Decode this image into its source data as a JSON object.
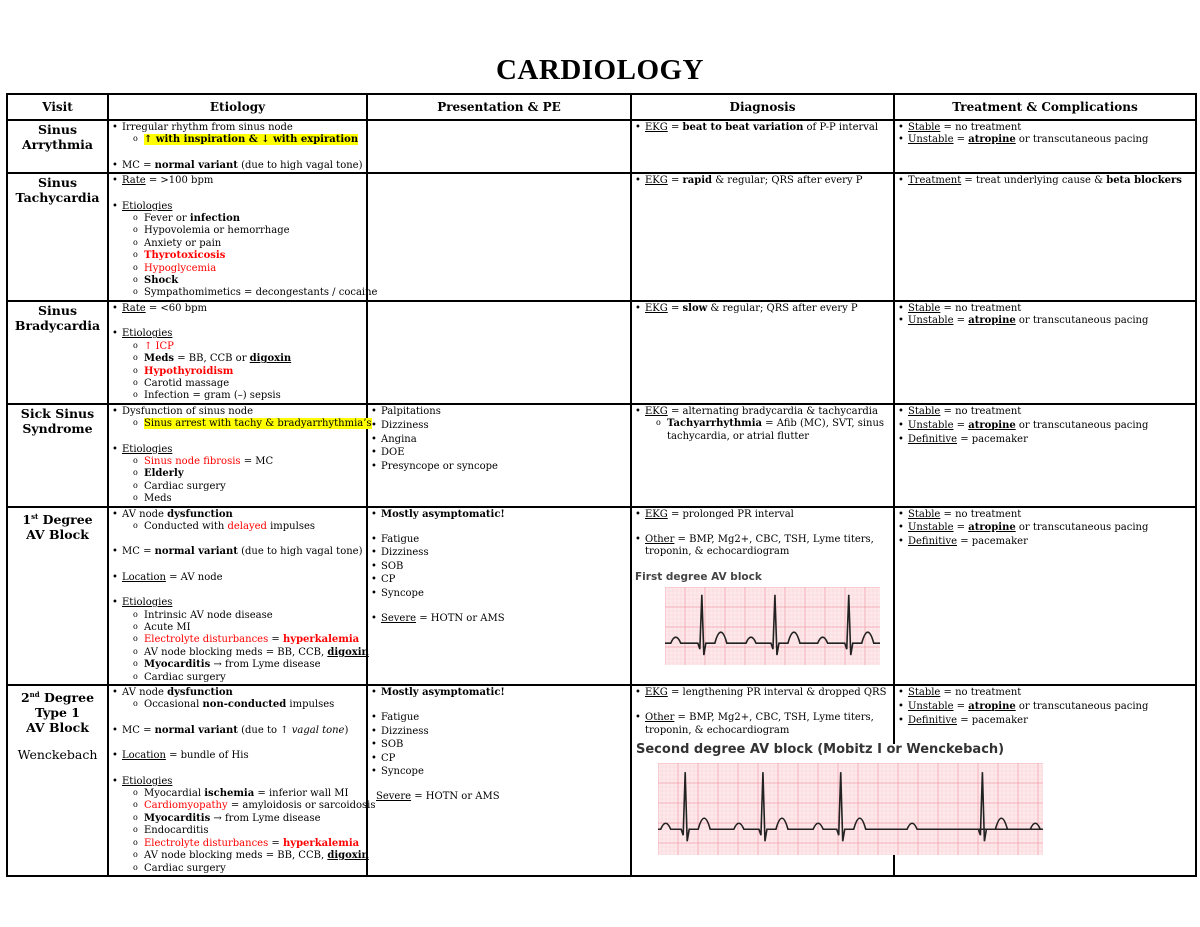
{
  "title": "CARDIOLOGY",
  "headers": [
    "Visit",
    "Etiology",
    "Presentation & PE",
    "Diagnosis",
    "Treatment & Complications"
  ],
  "rows": [
    {
      "visit": [
        "Sinus",
        "Arrythmia"
      ],
      "etiology": {
        "b1": "Irregular rhythm from sinus node",
        "s1": "↑ with inspiration & ↓ with expiration",
        "b2_pre": "MC = ",
        "b2_bold": "normal variant",
        "b2_post": " (due to high vagal tone)"
      },
      "diagnosis": {
        "label": "EKG",
        "eq": " = ",
        "bold": "beat to beat variation",
        "post": " of P-P interval"
      },
      "treatment": {
        "stable_label": "Stable",
        "stable_text": " = no treatment",
        "unstable_label": "Unstable",
        "unstable_eq": " = ",
        "unstable_bold": "atropine",
        "unstable_post": " or transcutaneous pacing"
      }
    },
    {
      "visit": [
        "Sinus",
        "Tachycardia"
      ],
      "etiology": {
        "rate_label": "Rate",
        "rate_text": " = >100 bpm",
        "etio_label": "Etiologies",
        "items": [
          {
            "pre": "Fever or ",
            "bold": "infection"
          },
          {
            "pre": "Hypovolemia or hemorrhage"
          },
          {
            "pre": "Anxiety or pain"
          },
          {
            "red_bold": "Thyrotoxicosis"
          },
          {
            "red": "Hypoglycemia"
          },
          {
            "bold": "Shock"
          },
          {
            "pre": "Sympathomimetics = decongestants / cocaine"
          }
        ]
      },
      "diagnosis": {
        "label": "EKG",
        "eq": " = ",
        "bold": "rapid",
        "post": " & regular; QRS after every P"
      },
      "treatment": {
        "label": "Treatment",
        "text": " = treat underlying cause & ",
        "bold": "beta blockers"
      }
    },
    {
      "visit": [
        "Sinus",
        "Bradycardia"
      ],
      "etiology": {
        "rate_label": "Rate",
        "rate_text": " = <60 bpm",
        "etio_label": "Etiologies",
        "i1": "↑ ICP",
        "i2_bold": "Meds",
        "i2_mid": " = BB, CCB or ",
        "i2_bu": "digoxin",
        "i3": "Hypothyroidism",
        "i4": "Carotid massage",
        "i5": "Infection = gram (–) sepsis"
      },
      "diagnosis": {
        "label": "EKG",
        "eq": " = ",
        "bold": "slow",
        "post": " & regular; QRS after every P"
      },
      "treatment": {
        "stable_label": "Stable",
        "stable_text": " = no treatment",
        "unstable_label": "Unstable",
        "unstable_eq": " = ",
        "unstable_bold": "atropine",
        "unstable_post": " or transcutaneous pacing"
      }
    },
    {
      "visit": [
        "Sick Sinus",
        "Syndrome"
      ],
      "etiology": {
        "b1": "Dysfunction of sinus node",
        "s1": "Sinus arrest with tachy & bradyarrhythmia’s",
        "etio_label": "Etiologies",
        "i1_red": "Sinus node fibrosis",
        "i1_post": " = MC",
        "i2": "Elderly",
        "i3": "Cardiac surgery",
        "i4": "Meds"
      },
      "presentation": [
        "Palpitations",
        "Dizziness",
        "Angina",
        "DOE",
        "Presyncope or syncope"
      ],
      "diagnosis": {
        "label": "EKG",
        "text": " = alternating bradycardia & tachycardia",
        "sub_bold": "Tachyarrhythmia",
        "sub_text": " = Afib (MC), SVT, sinus tachycardia, or atrial flutter"
      },
      "treatment": {
        "stable_label": "Stable",
        "stable_text": " = no treatment",
        "unstable_label": "Unstable",
        "unstable_eq": " = ",
        "unstable_bold": "atropine",
        "unstable_post": " or transcutaneous pacing",
        "definitive_label": "Definitive",
        "definitive_text": " = pacemaker"
      }
    },
    {
      "visit": [
        "1st Degree",
        "AV Block"
      ],
      "visit_sup": "st",
      "etiology": {
        "b1_pre": "AV node ",
        "b1_bold": "dysfunction",
        "s1_pre": "Conducted with ",
        "s1_red": "delayed",
        "s1_post": " impulses",
        "b2_pre": "MC = ",
        "b2_bold": "normal variant",
        "b2_post": " (due to high vagal tone)",
        "loc_label": "Location",
        "loc_text": " = AV node",
        "etio_label": "Etiologies",
        "i1": "Intrinsic AV node disease",
        "i2": "Acute MI",
        "i3_red": "Electrolyte disturbances",
        "i3_eq": " = ",
        "i3_redbold": "hyperkalemia",
        "i4_pre": "AV node blocking meds = BB, CCB, ",
        "i4_bu": "digoxin",
        "i5_bold": "Myocarditis",
        "i5_post": " → from Lyme disease",
        "i6": "Cardiac surgery"
      },
      "presentation": {
        "headline": "Mostly asymptomatic!",
        "items": [
          "Fatigue",
          "Dizziness",
          "SOB",
          "CP",
          "Syncope"
        ],
        "severe_label": "Severe",
        "severe_text": " = HOTN or AMS"
      },
      "diagnosis": {
        "label": "EKG",
        "text": " = prolonged PR interval",
        "other_label": "Other",
        "other_text": " = BMP, Mg2+, CBC, TSH, Lyme titers, troponin, & echocardiogram",
        "image_caption": "First degree AV block"
      },
      "treatment": {
        "stable_label": "Stable",
        "stable_text": " = no treatment",
        "unstable_label": "Unstable",
        "unstable_eq": " = ",
        "unstable_bold": "atropine",
        "unstable_post": " or transcutaneous pacing",
        "definitive_label": "Definitive",
        "definitive_text": " = pacemaker"
      }
    },
    {
      "visit": [
        "2nd Degree",
        "Type 1",
        "AV Block"
      ],
      "visit_sub": "Wenckebach",
      "etiology": {
        "b1_pre": "AV node ",
        "b1_bold": "dysfunction",
        "s1_pre": "Occasional ",
        "s1_bold": "non-conducted",
        "s1_post": " impulses",
        "b2_pre": "MC = ",
        "b2_bold": "normal variant",
        "b2_mid": " (due to ↑ ",
        "b2_ital": "vagal tone",
        "b2_post": ")",
        "loc_label": "Location",
        "loc_text": " = bundle of His",
        "etio_label": "Etiologies",
        "i1_pre": "Myocardial ",
        "i1_bold": "ischemia",
        "i1_post": " = inferior wall MI",
        "i2_red": "Cardiomyopathy",
        "i2_post": " = amyloidosis or sarcoidosis",
        "i3_bold": "Myocarditis",
        "i3_post": " → from Lyme disease",
        "i4": "Endocarditis",
        "i5_red": "Electrolyte disturbances",
        "i5_eq": " = ",
        "i5_redbold": "hyperkalemia",
        "i6_pre": "AV node blocking meds = BB, CCB, ",
        "i6_bu": "digoxin",
        "i7": "Cardiac surgery"
      },
      "presentation": {
        "headline": "Mostly asymptomatic!",
        "items": [
          "Fatigue",
          "Dizziness",
          "SOB",
          "CP",
          "Syncope"
        ],
        "severe_label": "Severe",
        "severe_text": " = HOTN or AMS"
      },
      "diagnosis": {
        "label": "EKG",
        "text": " = lengthening PR interval & dropped QRS",
        "other_label": "Other",
        "other_text": " = BMP, Mg2+, CBC, TSH, Lyme titers, troponin, & echocardiogram",
        "image_caption": "Second degree AV block (Mobitz I or Wenckebach)"
      },
      "treatment": {
        "stable_label": "Stable",
        "stable_text": " = no treatment",
        "unstable_label": "Unstable",
        "unstable_eq": " = ",
        "unstable_bold": "atropine",
        "unstable_post": " or transcutaneous pacing",
        "definitive_label": "Definitive",
        "definitive_text": " = pacemaker"
      }
    }
  ]
}
